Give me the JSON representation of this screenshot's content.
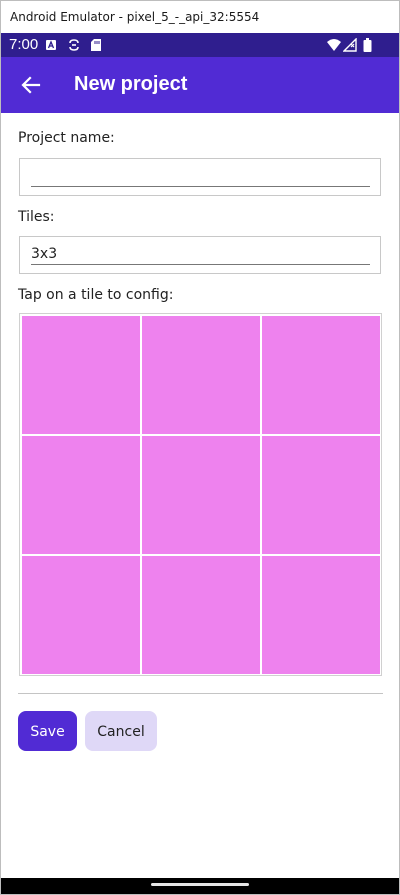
{
  "window": {
    "title": "Android Emulator - pixel_5_-_api_32:5554"
  },
  "status_bar": {
    "time": "7:00"
  },
  "app_bar": {
    "title": "New project"
  },
  "form": {
    "project_name_label": "Project name:",
    "project_name_value": "",
    "tiles_label": "Tiles:",
    "tiles_value": "3x3",
    "tap_instruction": "Tap on a tile to config:"
  },
  "tile_grid": {
    "rows": 3,
    "columns": 3,
    "tile_color": "#ee82ee"
  },
  "buttons": {
    "save_label": "Save",
    "cancel_label": "Cancel"
  },
  "colors": {
    "primary": "#512bd4",
    "status_bar": "#2f1e8e",
    "secondary_button": "#dfd8f7"
  }
}
